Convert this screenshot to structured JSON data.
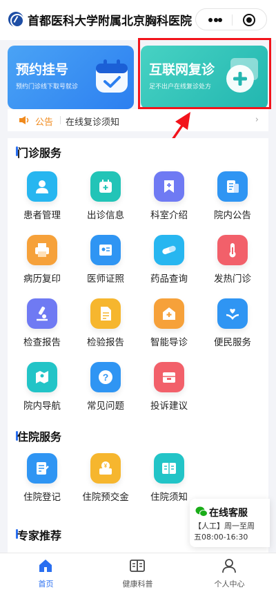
{
  "header": {
    "title": "首都医科大学附属北京胸科医院"
  },
  "cards": {
    "booking": {
      "title": "预约挂号",
      "subtitle": "预约门诊线下取号就诊"
    },
    "revisit": {
      "title": "互联网复诊",
      "subtitle": "足不出户在线复诊处方"
    }
  },
  "notice": {
    "label": "公告",
    "text": "在线复诊须知",
    "chevron": "›"
  },
  "outpatient": {
    "title": "门诊服务",
    "items": [
      {
        "label": "患者管理",
        "icon": "patient-icon",
        "color": "#27b6f0"
      },
      {
        "label": "出诊信息",
        "icon": "calendar-icon",
        "color": "#22c4b7"
      },
      {
        "label": "科室介绍",
        "icon": "bookmark-icon",
        "color": "#6f7af3"
      },
      {
        "label": "院内公告",
        "icon": "notice-doc-icon",
        "color": "#2f95f3"
      },
      {
        "label": "病历复印",
        "icon": "printer-icon",
        "color": "#f6a13a"
      },
      {
        "label": "医师证照",
        "icon": "badge-icon",
        "color": "#2f95f3"
      },
      {
        "label": "药品查询",
        "icon": "pill-icon",
        "color": "#27b6f0"
      },
      {
        "label": "发热门诊",
        "icon": "thermometer-icon",
        "color": "#f2606a"
      },
      {
        "label": "检查报告",
        "icon": "microscope-icon",
        "color": "#6f7af3"
      },
      {
        "label": "检验报告",
        "icon": "report-icon",
        "color": "#f6b62e"
      },
      {
        "label": "智能导诊",
        "icon": "hospital-icon",
        "color": "#f6a13a"
      },
      {
        "label": "便民服务",
        "icon": "heart-hand-icon",
        "color": "#2f95f3"
      },
      {
        "label": "院内导航",
        "icon": "map-icon",
        "color": "#22c4c7"
      },
      {
        "label": "常见问题",
        "icon": "question-icon",
        "color": "#2f95f3"
      },
      {
        "label": "投诉建议",
        "icon": "mailbox-icon",
        "color": "#f2606a"
      }
    ]
  },
  "inpatient": {
    "title": "住院服务",
    "items": [
      {
        "label": "住院登记",
        "icon": "register-icon",
        "color": "#2f95f3"
      },
      {
        "label": "住院预交金",
        "icon": "deposit-icon",
        "color": "#f6b62e"
      },
      {
        "label": "住院须知",
        "icon": "book-icon",
        "color": "#22c4c7"
      }
    ]
  },
  "experts": {
    "title": "专家推荐"
  },
  "customer_service": {
    "title": "在线客服",
    "line1": "【人工】周一至周",
    "line2": "五08:00-16:30"
  },
  "tabbar": {
    "items": [
      {
        "label": "首页",
        "icon": "home-icon",
        "active": true
      },
      {
        "label": "健康科普",
        "icon": "book-open-icon",
        "active": false
      },
      {
        "label": "个人中心",
        "icon": "user-icon",
        "active": false
      }
    ]
  },
  "colors": {
    "primary": "#2a6ff0",
    "highlight": "#f2131b",
    "notice": "#f08a1d"
  }
}
